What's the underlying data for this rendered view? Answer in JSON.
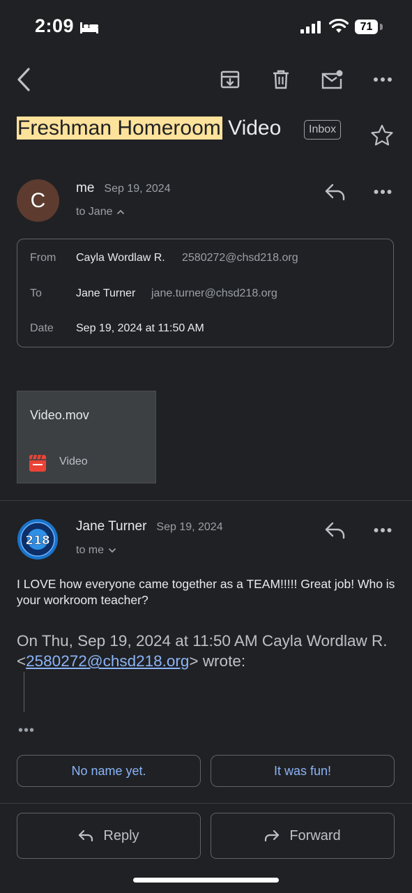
{
  "status_bar": {
    "time": "2:09",
    "battery": "71"
  },
  "toolbar": {
    "icons": [
      "back-icon",
      "archive-icon",
      "trash-icon",
      "mark-unread-icon",
      "more-icon"
    ]
  },
  "subject": {
    "highlighted": "Freshman Homeroom",
    "rest": " Video",
    "label_chip": "Inbox"
  },
  "message1": {
    "avatar_letter": "C",
    "avatar_color": "#5d3b2f",
    "sender": "me",
    "date": "Sep 19, 2024",
    "to": "to Jane",
    "details": {
      "from_label": "From",
      "from_name": "Cayla Wordlaw R.",
      "from_email": "2580272@chsd218.org",
      "to_label": "To",
      "to_name": "Jane Turner",
      "to_email": "jane.turner@chsd218.org",
      "date_label": "Date",
      "date_value": "Sep 19, 2024 at 11:50 AM"
    },
    "attachment": {
      "name": "Video.mov",
      "type": "Video"
    }
  },
  "message2": {
    "avatar_text": "218",
    "sender": "Jane Turner",
    "date": "Sep 19, 2024",
    "to": "to me",
    "body": "I LOVE how everyone came together as a TEAM!!!!! Great job! Who is your workroom teacher?",
    "quote_prefix": "On Thu, Sep 19, 2024 at 11:50 AM Cayla Wordlaw R. <",
    "quote_email": "2580272@chsd218.org",
    "quote_suffix": "> wrote:",
    "more": "•••"
  },
  "smart_replies": [
    "No name yet.",
    "It was fun!"
  ],
  "actions": {
    "reply": "Reply",
    "forward": "Forward"
  },
  "colors": {
    "background": "#202124",
    "link": "#8ab4f8",
    "highlight": "#fce29b",
    "video_icon": "#ea4335"
  }
}
